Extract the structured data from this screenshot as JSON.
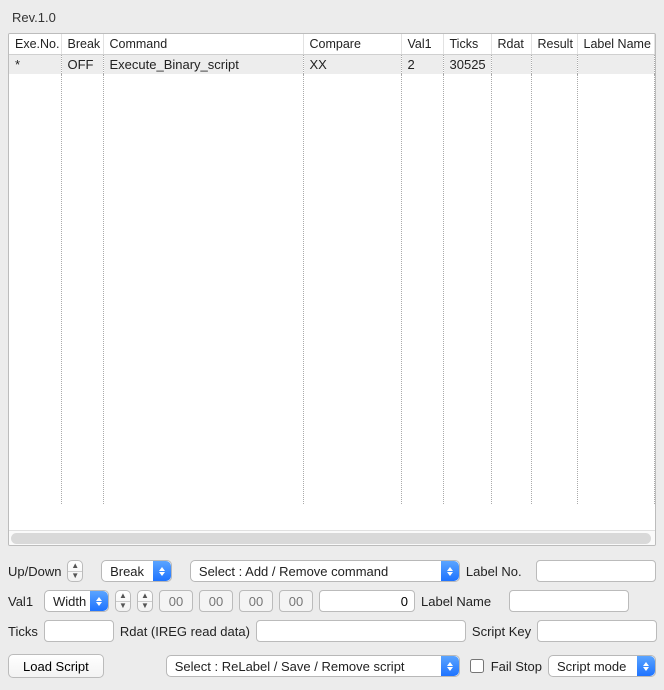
{
  "title": "Rev.1.0",
  "table": {
    "headers": [
      "Exe.No.",
      "Break",
      "Command",
      "Compare",
      "Val1",
      "Ticks",
      "Rdat",
      "Result",
      "Label Name"
    ],
    "row": {
      "exe_no": "*",
      "break": "OFF",
      "command": "Execute_Binary_script",
      "compare": "XX",
      "val1": "2",
      "ticks": "30525",
      "rdat": "",
      "result": "",
      "label_name": ""
    }
  },
  "row1": {
    "updown_label": "Up/Down",
    "break_select": "Break",
    "command_select": "Select : Add / Remove command",
    "label_no_label": "Label No.",
    "label_no_value": ""
  },
  "row2": {
    "val1_label": "Val1",
    "width_select": "Width",
    "hex_ph1": "00",
    "hex_ph2": "00",
    "hex_ph3": "00",
    "hex_ph4": "00",
    "num_value": "0",
    "label_name_label": "Label Name",
    "label_name_value": ""
  },
  "row3": {
    "ticks_label": "Ticks",
    "ticks_value": "",
    "rdat_label": "Rdat (IREG read data)",
    "rdat_value": "",
    "script_key_label": "Script Key",
    "script_key_value": ""
  },
  "row4": {
    "load_script": "Load Script",
    "script_select": "Select : ReLabel / Save / Remove script",
    "fail_stop_label": "Fail Stop",
    "mode_select": "Script mode"
  }
}
